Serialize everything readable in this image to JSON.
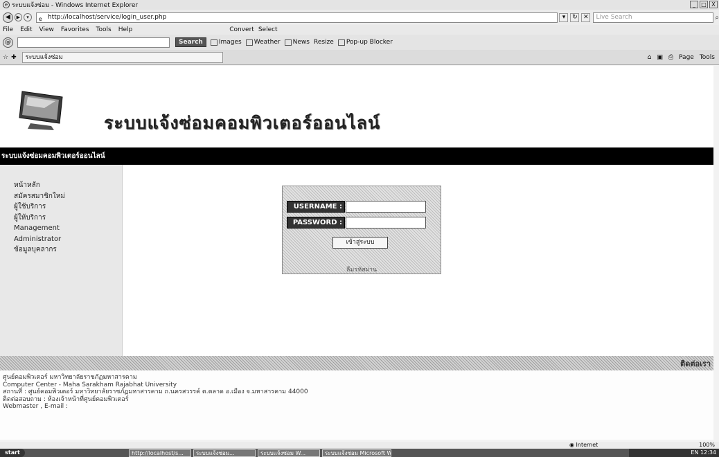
{
  "window": {
    "title": "ระบบแจ้งซ่อม - Windows Internet Explorer",
    "controls": [
      "_",
      "□",
      "X"
    ]
  },
  "address_bar": {
    "url": "http://localhost/service/login_user.php",
    "search_placeholder": "Live Search"
  },
  "menu": {
    "items": [
      "File",
      "Edit",
      "View",
      "Favorites",
      "Tools",
      "Help"
    ],
    "convert_label": "Convert",
    "select_label": "Select"
  },
  "toolbar": {
    "search_label": "Search",
    "images_label": "Images",
    "weather_label": "Weather",
    "news_label": "News",
    "resize_label": "Resize",
    "popup_label": "Pop-up Blocker"
  },
  "tab": {
    "label": "ระบบแจ้งซ่อม",
    "page_label": "Page",
    "tools_label": "Tools"
  },
  "site": {
    "title": "ระบบแจ้งซ่อมคอมพิวเตอร์ออนไลน์",
    "bar_text": "ระบบแจ้งซ่อมคอมพิวเตอร์ออนไลน์"
  },
  "sidebar": {
    "items": [
      {
        "label": "หน้าหลัก"
      },
      {
        "label": "สมัครสมาชิกใหม่"
      },
      {
        "label": "ผู้ใช้บริการ"
      },
      {
        "label": "ผู้ให้บริการ"
      },
      {
        "label": "Management"
      },
      {
        "label": "Administrator"
      },
      {
        "label": "ข้อมูลบุคลากร"
      }
    ]
  },
  "login": {
    "username_label": "USERNAME :",
    "password_label": "PASSWORD :",
    "username_value": "",
    "password_value": "",
    "submit_label": "เข้าสู่ระบบ",
    "footer_label": "ลืมรหัสผ่าน"
  },
  "footer": {
    "bar_right": "ติดต่อเรา",
    "lines": [
      "ศูนย์คอมพิวเตอร์ มหาวิทยาลัยราชภัฏมหาสารคาม",
      "Computer Center - Maha Sarakham Rajabhat University",
      "สถานที่ : ศูนย์คอมพิวเตอร์ มหาวิทยาลัยราชภัฏมหาสารคาม ถ.นครสวรรค์ ต.ตลาด อ.เมือง จ.มหาสารคาม 44000",
      "ติดต่อสอบถาม : ห้องเจ้าหน้าที่ศูนย์คอมพิวเตอร์",
      "Webmaster , E-mail :"
    ]
  },
  "status": {
    "zone": "Internet",
    "zoom": "100%"
  },
  "taskbar": {
    "start": "start",
    "tasks": [
      "http://localhost/s...",
      "ระบบแจ้งซ่อม...",
      "ระบบแจ้งซ่อม W...",
      "ระบบแจ้งซ่อม Microsoft W..."
    ],
    "tray": "EN 12:34"
  }
}
